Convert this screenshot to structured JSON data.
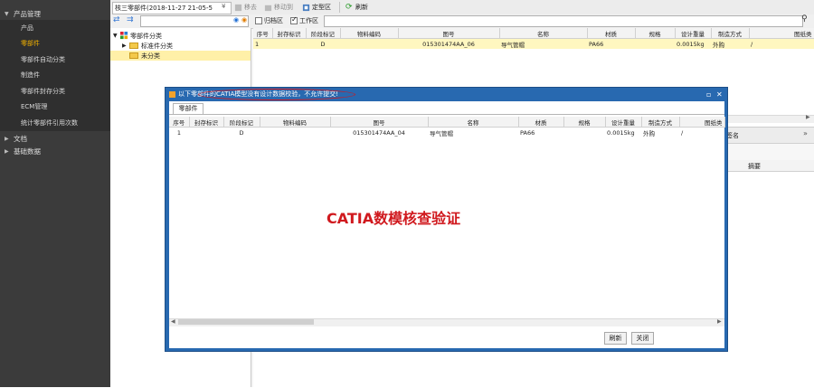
{
  "sidebar": {
    "section_product": "产品管理",
    "items": [
      {
        "label": "产品",
        "active": false
      },
      {
        "label": "零部件",
        "active": true
      },
      {
        "label": "零部件自动分类",
        "active": false
      },
      {
        "label": "制造件",
        "active": false
      },
      {
        "label": "零部件封存分类",
        "active": false
      },
      {
        "label": "ECM管理",
        "active": false
      },
      {
        "label": "统计零部件引用次数",
        "active": false
      }
    ],
    "section_docs": "文档",
    "section_base": "基础数据"
  },
  "toolbar": {
    "tab_title": "核三零部件(2018-11-27  21-05-5",
    "dropdown_glyph": "¥",
    "buttons": [
      {
        "label": "移去",
        "enabled": false
      },
      {
        "label": "移动到",
        "enabled": false
      },
      {
        "label": "定型区",
        "enabled": true
      },
      {
        "label": "刷新",
        "enabled": true
      }
    ]
  },
  "bar2": {
    "archive_label": "归档区",
    "archive_checked": false,
    "work_label": "工作区",
    "work_checked": true
  },
  "tree": {
    "root": "零部件分类",
    "children": [
      "标准件分类",
      "未分类"
    ],
    "selected": "未分类"
  },
  "grid": {
    "headers": [
      "序号",
      "封存标识",
      "阶段标记",
      "物料编码",
      "图号",
      "名称",
      "材质",
      "规格",
      "设计重量",
      "制造方式",
      "图纸类"
    ],
    "rows": [
      [
        "1",
        "",
        "D",
        "",
        "015301474AA_06",
        "导气管帽",
        "PA66",
        "",
        "0.0015kg",
        "外购",
        "/",
        ""
      ]
    ]
  },
  "side_panel": {
    "tab_label": "签名",
    "column_label": "摘要",
    "collapse_glyph": "»"
  },
  "dialog": {
    "title": "以下零部件的CATIA模型没有设计数据校验，不允许提交!",
    "tab": "零部件",
    "headers": [
      "序号",
      "封存标识",
      "阶段标记",
      "物料编码",
      "图号",
      "名称",
      "材质",
      "规格",
      "设计重量",
      "制造方式",
      "图纸类"
    ],
    "rows": [
      [
        "1",
        "",
        "D",
        "",
        "015301474AA_04",
        "导气管帽",
        "PA66",
        "",
        "0.0015kg",
        "外购",
        "/",
        ""
      ]
    ],
    "refresh_button": "刷新",
    "close_button": "关闭"
  },
  "annotation": {
    "text": "CATIA数模核查验证",
    "color": "#d0191e"
  },
  "colors": {
    "sidebar_bg": "#3b3b3b",
    "active_item": "#f0b000",
    "dialog_border": "#2869b0",
    "selected_row": "#fff7c0"
  }
}
